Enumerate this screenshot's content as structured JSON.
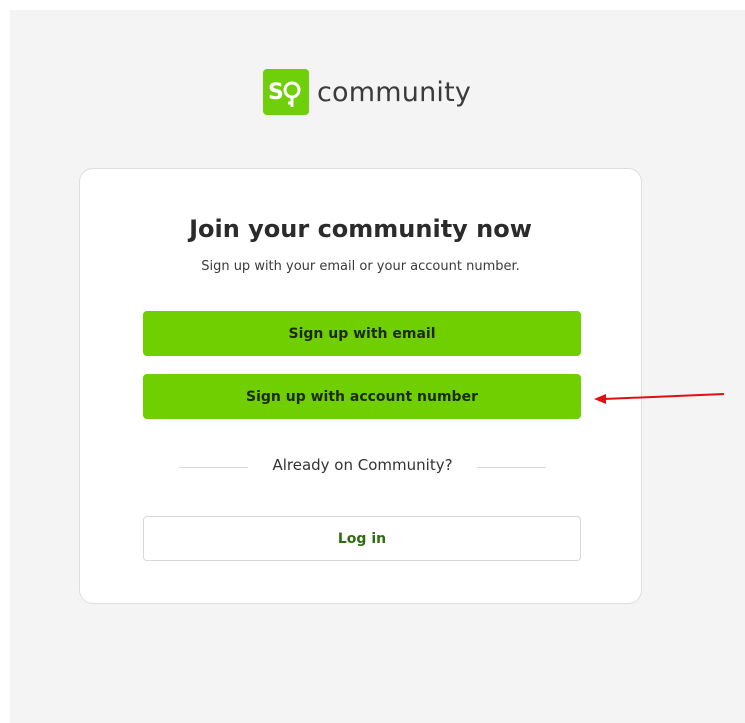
{
  "brand": {
    "logo_text": "Sq",
    "name": "community",
    "accent_color": "#6fcf00"
  },
  "card": {
    "title": "Join your community now",
    "subtitle": "Sign up with your email or your account number."
  },
  "actions": {
    "signup_email_label": "Sign up with email",
    "signup_account_label": "Sign up with account number",
    "divider_text": "Already on Community?",
    "login_label": "Log in"
  },
  "annotation": {
    "arrow_color": "#e01010",
    "icon": "arrow-left-icon"
  }
}
